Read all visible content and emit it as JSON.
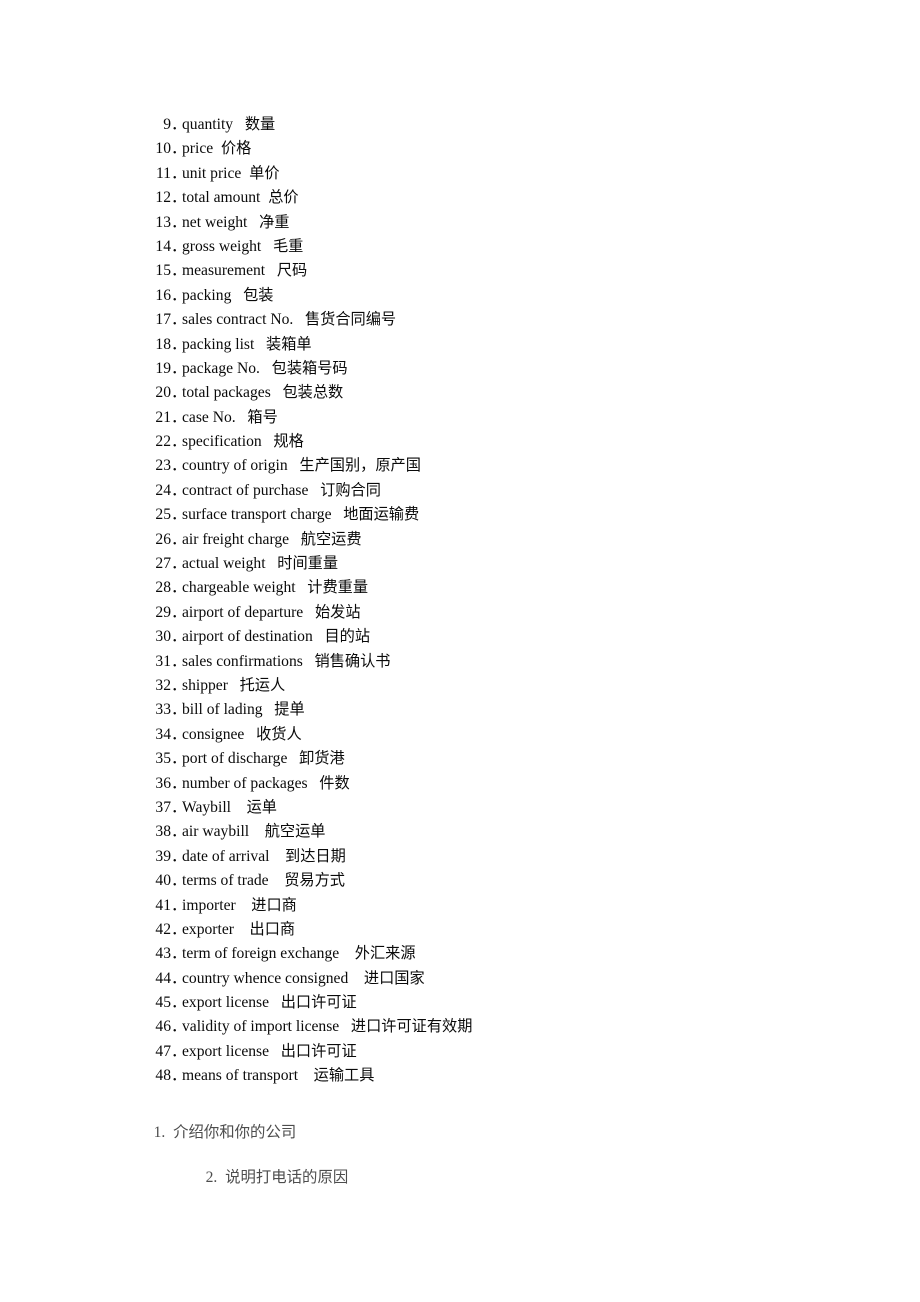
{
  "page": {
    "background": "#ffffff",
    "text_color": "#0a0a0a",
    "muted_text_color": "#4d4d4d"
  },
  "glossary": {
    "separator_dot": "．",
    "items": [
      {
        "num": "9",
        "en": "quantity",
        "gap": "   ",
        "cn": "数量"
      },
      {
        "num": "10",
        "en": "price",
        "gap": "  ",
        "cn": "价格"
      },
      {
        "num": "11",
        "en": "unit price",
        "gap": "  ",
        "cn": "单价"
      },
      {
        "num": "12",
        "en": "total amount",
        "gap": "  ",
        "cn": "总价"
      },
      {
        "num": "13",
        "en": "net weight",
        "gap": "   ",
        "cn": "净重"
      },
      {
        "num": "14",
        "en": "gross weight",
        "gap": "   ",
        "cn": "毛重"
      },
      {
        "num": "15",
        "en": "measurement",
        "gap": "   ",
        "cn": "尺码"
      },
      {
        "num": "16",
        "en": "packing",
        "gap": "   ",
        "cn": "包装"
      },
      {
        "num": "17",
        "en": "sales contract No.",
        "gap": "   ",
        "cn": "售货合同编号"
      },
      {
        "num": "18",
        "en": "packing list",
        "gap": "   ",
        "cn": "装箱单"
      },
      {
        "num": "19",
        "en": "package No.",
        "gap": "   ",
        "cn": "包装箱号码"
      },
      {
        "num": "20",
        "en": "total packages",
        "gap": "   ",
        "cn": "包装总数"
      },
      {
        "num": "21",
        "en": "case No.",
        "gap": "   ",
        "cn": "箱号"
      },
      {
        "num": "22",
        "en": "specification",
        "gap": "   ",
        "cn": "规格"
      },
      {
        "num": "23",
        "en": "country of origin",
        "gap": "   ",
        "cn": "生产国别，原产国"
      },
      {
        "num": "24",
        "en": "contract of purchase",
        "gap": "   ",
        "cn": "订购合同"
      },
      {
        "num": "25",
        "en": "surface transport charge",
        "gap": "   ",
        "cn": "地面运输费"
      },
      {
        "num": "26",
        "en": "air freight charge",
        "gap": "   ",
        "cn": "航空运费"
      },
      {
        "num": "27",
        "en": "actual weight",
        "gap": "   ",
        "cn": "时间重量"
      },
      {
        "num": "28",
        "en": "chargeable weight",
        "gap": "   ",
        "cn": "计费重量"
      },
      {
        "num": "29",
        "en": "airport of departure",
        "gap": "   ",
        "cn": "始发站"
      },
      {
        "num": "30",
        "en": "airport of destination",
        "gap": "   ",
        "cn": "目的站"
      },
      {
        "num": "31",
        "en": "sales confirmations",
        "gap": "   ",
        "cn": "销售确认书"
      },
      {
        "num": "32",
        "en": "shipper",
        "gap": "   ",
        "cn": "托运人"
      },
      {
        "num": "33",
        "en": "bill of lading",
        "gap": "   ",
        "cn": "提单"
      },
      {
        "num": "34",
        "en": "consignee",
        "gap": "   ",
        "cn": "收货人"
      },
      {
        "num": "35",
        "en": "port of discharge",
        "gap": "   ",
        "cn": "卸货港"
      },
      {
        "num": "36",
        "en": "number of packages",
        "gap": "   ",
        "cn": "件数"
      },
      {
        "num": "37",
        "en": "Waybill",
        "gap": "    ",
        "cn": "运单"
      },
      {
        "num": "38",
        "en": "air waybill",
        "gap": "    ",
        "cn": "航空运单"
      },
      {
        "num": "39",
        "en": "date of arrival",
        "gap": "    ",
        "cn": "到达日期"
      },
      {
        "num": "40",
        "en": "terms of trade",
        "gap": "    ",
        "cn": "贸易方式"
      },
      {
        "num": "41",
        "en": "importer",
        "gap": "    ",
        "cn": "进口商"
      },
      {
        "num": "42",
        "en": "exporter",
        "gap": "    ",
        "cn": "出口商"
      },
      {
        "num": "43",
        "en": "term of foreign exchange",
        "gap": "    ",
        "cn": "外汇来源"
      },
      {
        "num": "44",
        "en": "country whence consigned",
        "gap": "    ",
        "cn": "进口国家"
      },
      {
        "num": "45",
        "en": "export license",
        "gap": "   ",
        "cn": "出口许可证"
      },
      {
        "num": "46",
        "en": "validity of import license",
        "gap": "   ",
        "cn": "进口许可证有效期"
      },
      {
        "num": "47",
        "en": "export license",
        "gap": "   ",
        "cn": "出口许可证"
      },
      {
        "num": "48",
        "en": "means of transport",
        "gap": "    ",
        "cn": "运输工具"
      }
    ]
  },
  "outline": {
    "items": [
      {
        "num": "1.",
        "gap": "  ",
        "cn": "介绍你和你的公司"
      },
      {
        "num": "2.",
        "gap": "  ",
        "cn": "说明打电话的原因"
      }
    ]
  }
}
